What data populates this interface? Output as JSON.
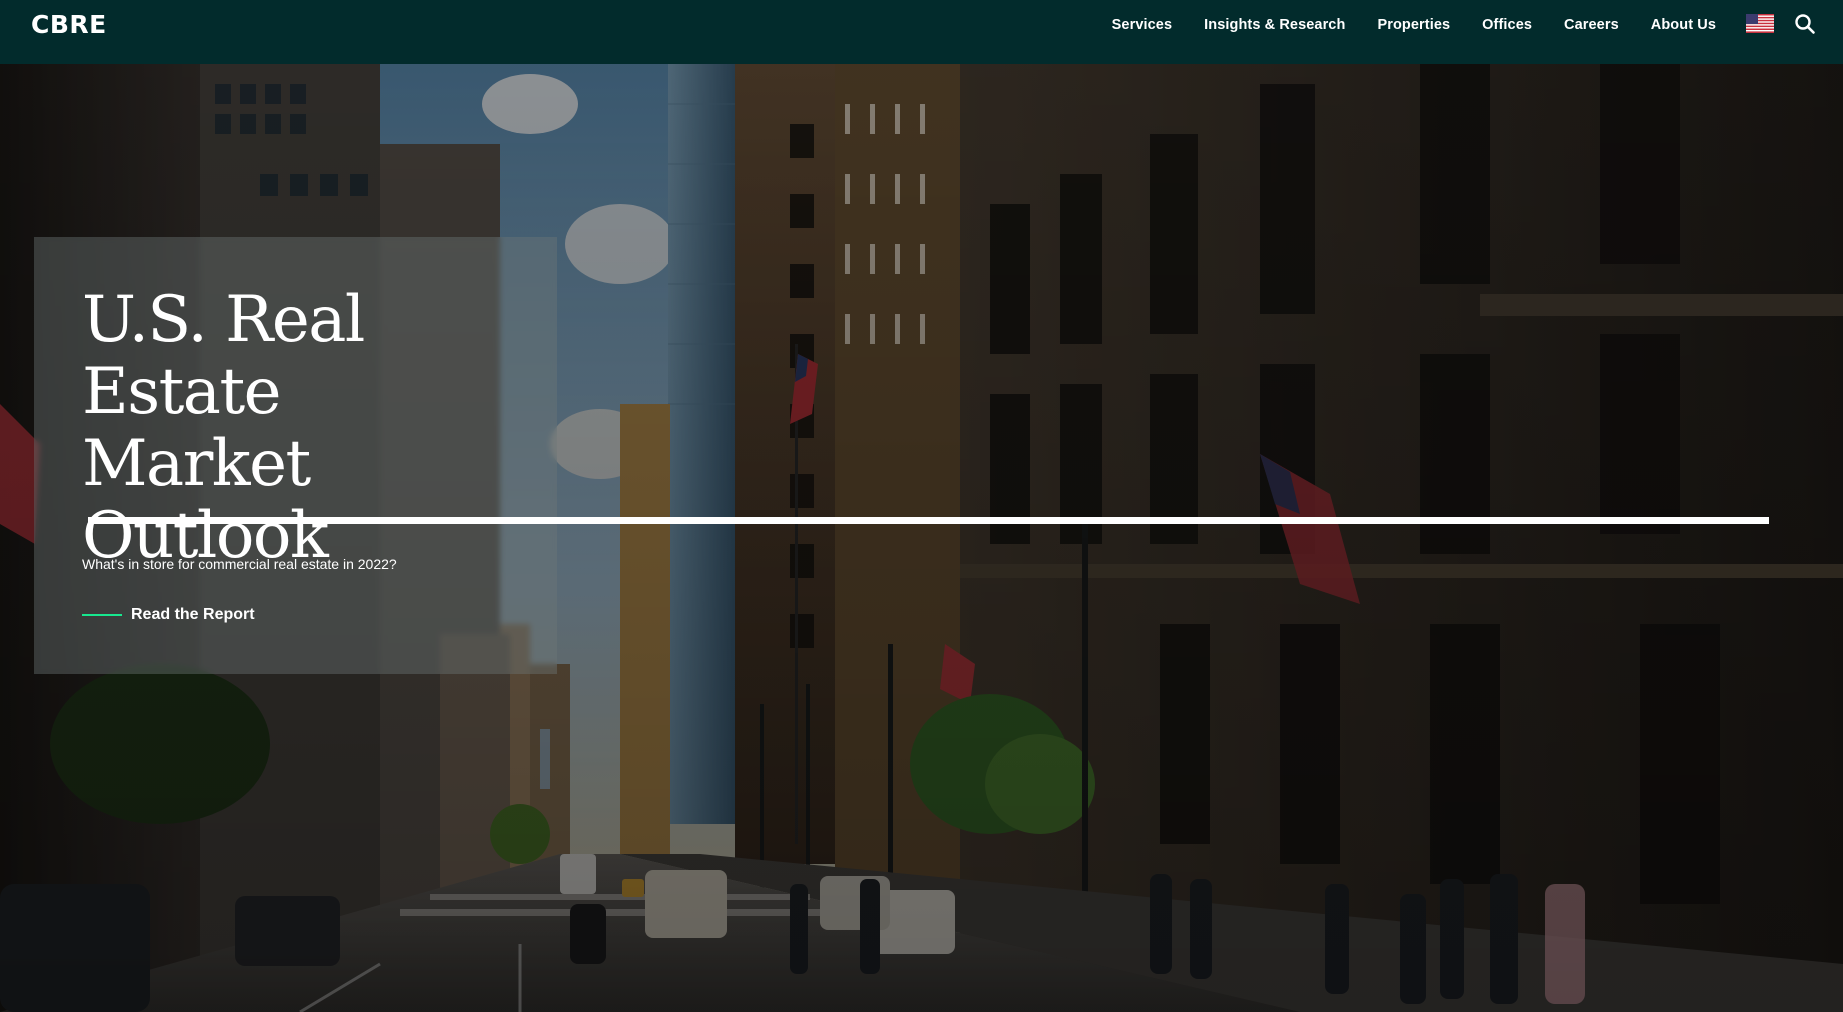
{
  "brand": {
    "logo_text": "CBRE"
  },
  "nav": {
    "items": [
      {
        "label": "Services"
      },
      {
        "label": "Insights & Research"
      },
      {
        "label": "Properties"
      },
      {
        "label": "Offices"
      },
      {
        "label": "Careers"
      },
      {
        "label": "About Us"
      }
    ],
    "region_icon": "us-flag-icon",
    "search_icon": "search-icon"
  },
  "hero": {
    "title_lines": [
      "U.S. Real Estate",
      "Market",
      "Outlook"
    ],
    "subtitle": "What's in store for commercial real estate in 2022?",
    "cta_label": "Read the Report"
  },
  "colors": {
    "nav_bg": "#022b2c",
    "accent": "#17e88f",
    "text": "#ffffff"
  }
}
